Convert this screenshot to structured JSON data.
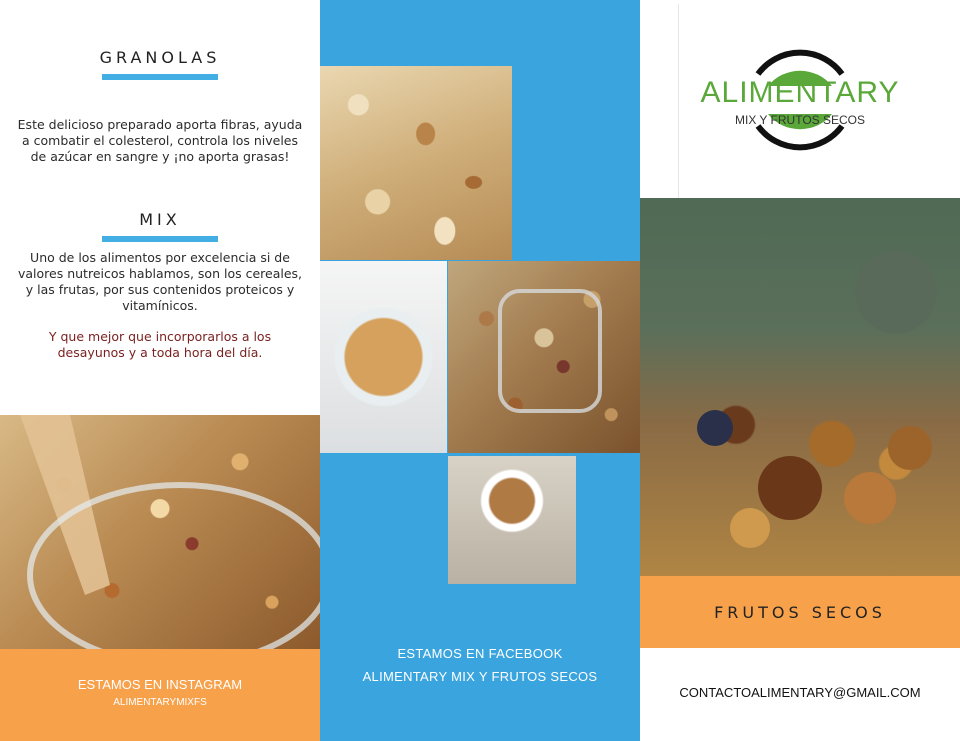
{
  "left": {
    "granolas_title": "GRANOLAS",
    "granolas_text": "Este delicioso preparado aporta fibras, ayuda a combatir el colesterol, controla los niveles de azúcar en sangre y ¡no aporta grasas!",
    "mix_title": "MIX",
    "mix_text": "Uno de los alimentos por excelencia si de valores nutreicos hablamos, son los cereales, y las frutas, por sus contenidos proteicos y vitamínicos.",
    "mix_highlight": "Y que mejor que incorporarlos a los desayunos  y a toda hora del día.",
    "instagram_label": "ESTAMOS EN INSTAGRAM",
    "instagram_handle": "ALIMENTARYMIXFS"
  },
  "middle": {
    "facebook_label": "ESTAMOS EN FACEBOOK",
    "facebook_page": "ALIMENTARY MIX Y FRUTOS SECOS"
  },
  "right": {
    "logo_name": "ALIMENTARY",
    "logo_tagline": "MIX Y FRUTOS SECOS",
    "frutos_title": "FRUTOS SECOS",
    "email": "CONTACTOALIMENTARY@GMAIL.COM"
  },
  "colors": {
    "blue": "#3aa4df",
    "orange": "#f7a14b",
    "green": "#5aa83a",
    "accent_text": "#7a1f1f"
  }
}
